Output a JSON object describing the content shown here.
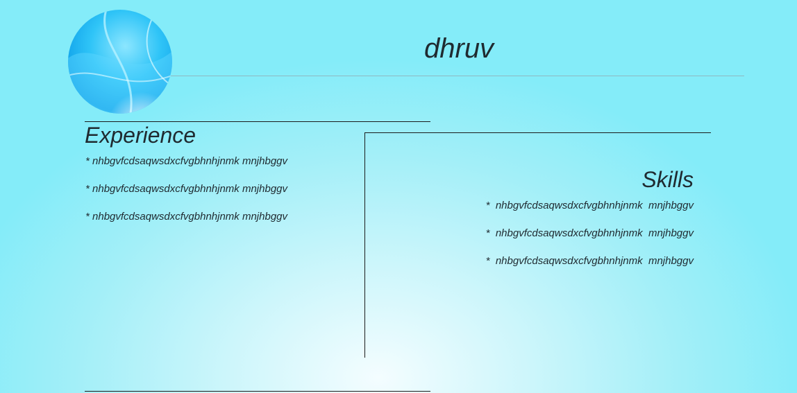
{
  "header": {
    "title": "dhruv",
    "logo_icon": "blue-orb-logo-icon"
  },
  "experience": {
    "heading": "Experience",
    "items": [
      "* nhbgvfcdsaqwsdxcfvgbhnhjnmk mnjhbggv",
      "* nhbgvfcdsaqwsdxcfvgbhnhjnmk mnjhbggv",
      "* nhbgvfcdsaqwsdxcfvgbhnhjnmk mnjhbggv"
    ]
  },
  "skills": {
    "heading": "Skills",
    "items": [
      "*  nhbgvfcdsaqwsdxcfvgbhnhjnmk  mnjhbggv",
      "*  nhbgvfcdsaqwsdxcfvgbhnhjnmk  mnjhbggv",
      "*  nhbgvfcdsaqwsdxcfvgbhnhjnmk  mnjhbggv"
    ]
  },
  "colors": {
    "background": "#a3eff8",
    "text": "#1f2a30",
    "orb": "#19c2f5"
  }
}
